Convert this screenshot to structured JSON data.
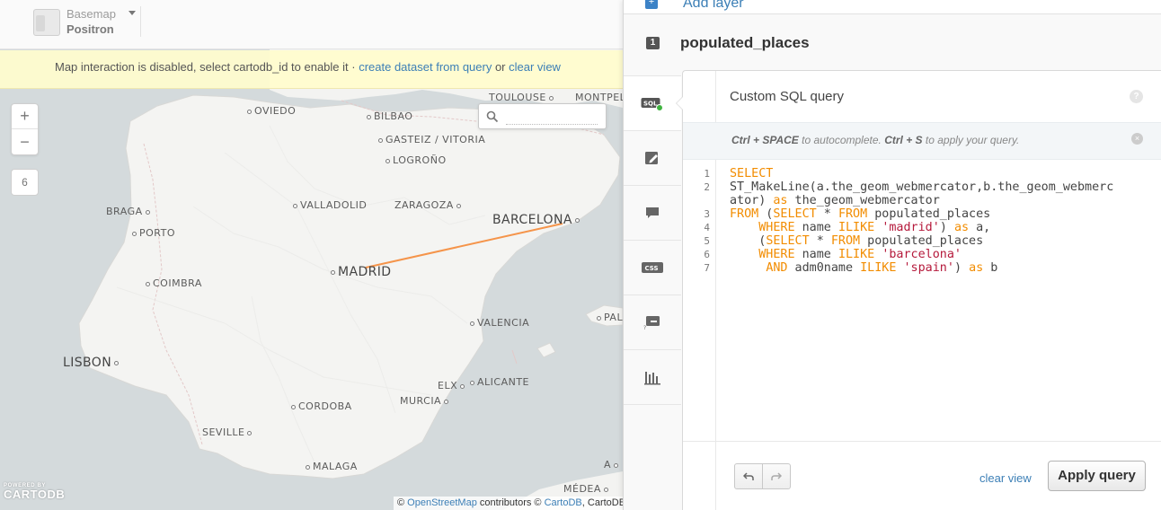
{
  "basemap": {
    "label": "Basemap",
    "value": "Positron"
  },
  "notice": {
    "text": "Map interaction is disabled, select cartodb_id to enable it · ",
    "link1": "create dataset from query",
    "or": " or ",
    "link2": "clear view"
  },
  "map": {
    "zoom_in": "+",
    "zoom_out": "−",
    "zoom_level": "6",
    "route_color": "#f5944a",
    "cities": [
      {
        "name": "TOULOUSE",
        "dot": true
      },
      {
        "name": "MONTPEL",
        "dot": false
      },
      {
        "name": "OVIEDO",
        "dot": true
      },
      {
        "name": "BILBAO",
        "dot": true
      },
      {
        "name": "GASTEIZ / VITORIA",
        "dot": true
      },
      {
        "name": "LOGROÑO",
        "dot": true
      },
      {
        "name": "BRAGA",
        "dot": true
      },
      {
        "name": "PORTO",
        "dot": true
      },
      {
        "name": "VALLADOLID",
        "dot": true
      },
      {
        "name": "ZARAGOZA",
        "dot": true
      },
      {
        "name": "BARCELONA",
        "dot": true
      },
      {
        "name": "MADRID",
        "dot": true
      },
      {
        "name": "COIMBRA",
        "dot": true
      },
      {
        "name": "VALENCIA",
        "dot": true
      },
      {
        "name": "PALM",
        "dot": true
      },
      {
        "name": "LISBON",
        "dot": true
      },
      {
        "name": "ELX",
        "dot": true
      },
      {
        "name": "ALICANTE",
        "dot": true
      },
      {
        "name": "MURCIA",
        "dot": true
      },
      {
        "name": "CORDOBA",
        "dot": true
      },
      {
        "name": "SEVILLE",
        "dot": true
      },
      {
        "name": "MALAGA",
        "dot": true
      },
      {
        "name": "MÉDEA",
        "dot": true
      },
      {
        "name": "A",
        "dot": true
      }
    ]
  },
  "logo": {
    "small": "POWERED BY",
    "big": "CARTODB"
  },
  "attribution": {
    "prefix": "© ",
    "osm": "OpenStreetMap",
    "mid": " contributors © ",
    "cartodb": "CartoDB",
    "suffix": ", CartoDB"
  },
  "panel": {
    "add_layer": "Add layer",
    "add_layer_icon": "+",
    "layer_number": "1",
    "layer_name": "populated_places",
    "toolbar": [
      {
        "name": "sql-icon",
        "active": true
      },
      {
        "name": "wizard-icon",
        "active": false
      },
      {
        "name": "infowindow-icon",
        "active": false
      },
      {
        "name": "css-icon",
        "active": false
      },
      {
        "name": "legend-icon",
        "active": false
      },
      {
        "name": "filters-icon",
        "active": false
      }
    ],
    "sql": {
      "title": "Custom SQL query",
      "help": "?",
      "hint": {
        "k1": "Ctrl + SPACE",
        "t1": " to autocomplete. ",
        "k2": "Ctrl + S",
        "t2": " to apply your query."
      },
      "close": "×",
      "lines": [
        {
          "n": "1",
          "parts": [
            [
              "kw",
              "SELECT"
            ]
          ]
        },
        {
          "n": "2",
          "parts": [
            [
              "",
              "ST_MakeLine(a.the_geom_webmercator,b.the_geom_webmerc"
            ]
          ]
        },
        {
          "n": "",
          "parts": [
            [
              "",
              "ator) "
            ],
            [
              "kw",
              "as"
            ],
            [
              "",
              " the_geom_webmercator"
            ]
          ]
        },
        {
          "n": "3",
          "parts": [
            [
              "kw",
              "FROM"
            ],
            [
              "",
              " ("
            ],
            [
              "kw",
              "SELECT"
            ],
            [
              "",
              " * "
            ],
            [
              "kw",
              "FROM"
            ],
            [
              "",
              " populated_places"
            ]
          ]
        },
        {
          "n": "4",
          "parts": [
            [
              "",
              "    "
            ],
            [
              "kw",
              "WHERE"
            ],
            [
              "",
              " name "
            ],
            [
              "kw",
              "ILIKE"
            ],
            [
              "",
              " "
            ],
            [
              "str",
              "'madrid'"
            ],
            [
              "",
              ") "
            ],
            [
              "kw",
              "as"
            ],
            [
              "",
              " a,"
            ]
          ]
        },
        {
          "n": "5",
          "parts": [
            [
              "",
              "    ("
            ],
            [
              "kw",
              "SELECT"
            ],
            [
              "",
              " * "
            ],
            [
              "kw",
              "FROM"
            ],
            [
              "",
              " populated_places"
            ]
          ]
        },
        {
          "n": "6",
          "parts": [
            [
              "",
              "    "
            ],
            [
              "kw",
              "WHERE"
            ],
            [
              "",
              " name "
            ],
            [
              "kw",
              "ILIKE"
            ],
            [
              "",
              " "
            ],
            [
              "str",
              "'barcelona'"
            ]
          ]
        },
        {
          "n": "7",
          "parts": [
            [
              "",
              "     "
            ],
            [
              "kw",
              "AND"
            ],
            [
              "",
              " adm0name "
            ],
            [
              "kw",
              "ILIKE"
            ],
            [
              "",
              " "
            ],
            [
              "str",
              "'spain'"
            ],
            [
              "",
              ") "
            ],
            [
              "kw",
              "as"
            ],
            [
              "",
              " b"
            ]
          ]
        }
      ],
      "clear_view": "clear view",
      "apply": "Apply query"
    }
  }
}
